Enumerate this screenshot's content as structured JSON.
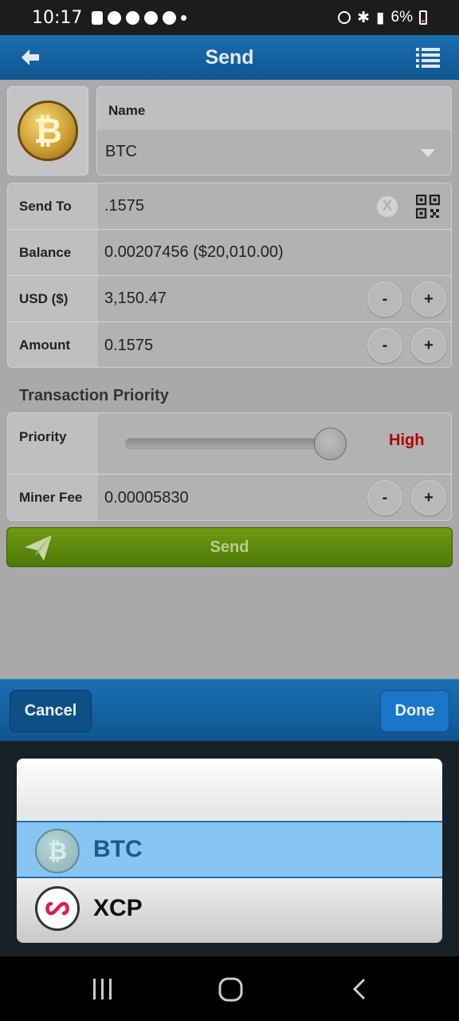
{
  "status": {
    "time": "10:17",
    "battery": "6%"
  },
  "header": {
    "title": "Send"
  },
  "coin": {
    "name_label": "Name",
    "name_value": "BTC"
  },
  "form": {
    "send_to_label": "Send To",
    "send_to_value": ".1575",
    "balance_label": "Balance",
    "balance_value": "0.00207456 ($20,010.00)",
    "usd_label": "USD ($)",
    "usd_value": "3,150.47",
    "amount_label": "Amount",
    "amount_value": "0.1575",
    "minus": "-",
    "plus": "+",
    "clear_symbol": "X"
  },
  "priority": {
    "section_title": "Transaction Priority",
    "label": "Priority",
    "level": "High",
    "slider_fraction": 1.0,
    "miner_fee_label": "Miner Fee",
    "miner_fee_value": "0.00005830"
  },
  "send_button": {
    "label": "Send"
  },
  "picker": {
    "cancel_label": "Cancel",
    "done_label": "Done",
    "options": [
      {
        "label": "BTC",
        "icon": "bitcoin-icon",
        "selected": true
      },
      {
        "label": "XCP",
        "icon": "counterparty-icon",
        "selected": false
      }
    ]
  },
  "colors": {
    "accent": "#1a6eb1",
    "send": "#5f8c0d",
    "priority_high": "#b30000",
    "selection": "#87c6f2"
  }
}
